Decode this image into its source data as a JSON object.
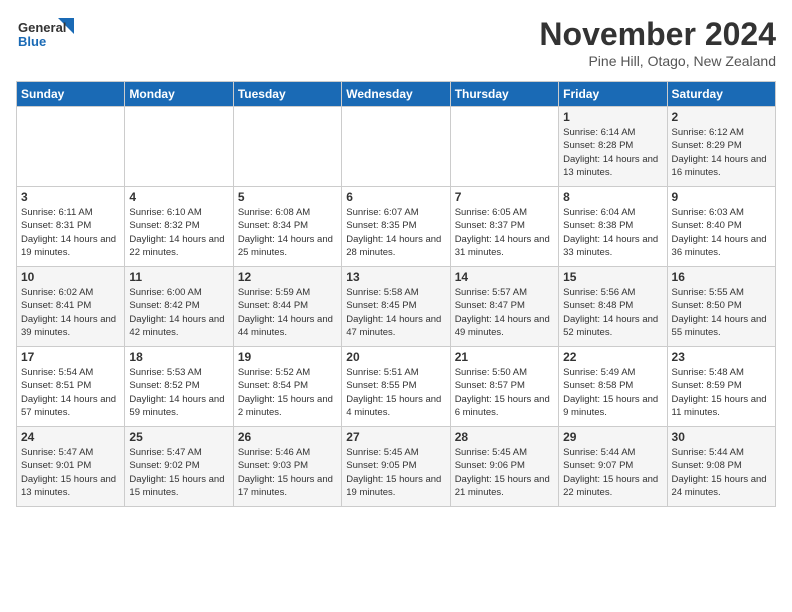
{
  "header": {
    "logo_general": "General",
    "logo_blue": "Blue",
    "title": "November 2024",
    "location": "Pine Hill, Otago, New Zealand"
  },
  "days_of_week": [
    "Sunday",
    "Monday",
    "Tuesday",
    "Wednesday",
    "Thursday",
    "Friday",
    "Saturday"
  ],
  "weeks": [
    [
      {
        "num": "",
        "info": ""
      },
      {
        "num": "",
        "info": ""
      },
      {
        "num": "",
        "info": ""
      },
      {
        "num": "",
        "info": ""
      },
      {
        "num": "",
        "info": ""
      },
      {
        "num": "1",
        "info": "Sunrise: 6:14 AM\nSunset: 8:28 PM\nDaylight: 14 hours and 13 minutes."
      },
      {
        "num": "2",
        "info": "Sunrise: 6:12 AM\nSunset: 8:29 PM\nDaylight: 14 hours and 16 minutes."
      }
    ],
    [
      {
        "num": "3",
        "info": "Sunrise: 6:11 AM\nSunset: 8:31 PM\nDaylight: 14 hours and 19 minutes."
      },
      {
        "num": "4",
        "info": "Sunrise: 6:10 AM\nSunset: 8:32 PM\nDaylight: 14 hours and 22 minutes."
      },
      {
        "num": "5",
        "info": "Sunrise: 6:08 AM\nSunset: 8:34 PM\nDaylight: 14 hours and 25 minutes."
      },
      {
        "num": "6",
        "info": "Sunrise: 6:07 AM\nSunset: 8:35 PM\nDaylight: 14 hours and 28 minutes."
      },
      {
        "num": "7",
        "info": "Sunrise: 6:05 AM\nSunset: 8:37 PM\nDaylight: 14 hours and 31 minutes."
      },
      {
        "num": "8",
        "info": "Sunrise: 6:04 AM\nSunset: 8:38 PM\nDaylight: 14 hours and 33 minutes."
      },
      {
        "num": "9",
        "info": "Sunrise: 6:03 AM\nSunset: 8:40 PM\nDaylight: 14 hours and 36 minutes."
      }
    ],
    [
      {
        "num": "10",
        "info": "Sunrise: 6:02 AM\nSunset: 8:41 PM\nDaylight: 14 hours and 39 minutes."
      },
      {
        "num": "11",
        "info": "Sunrise: 6:00 AM\nSunset: 8:42 PM\nDaylight: 14 hours and 42 minutes."
      },
      {
        "num": "12",
        "info": "Sunrise: 5:59 AM\nSunset: 8:44 PM\nDaylight: 14 hours and 44 minutes."
      },
      {
        "num": "13",
        "info": "Sunrise: 5:58 AM\nSunset: 8:45 PM\nDaylight: 14 hours and 47 minutes."
      },
      {
        "num": "14",
        "info": "Sunrise: 5:57 AM\nSunset: 8:47 PM\nDaylight: 14 hours and 49 minutes."
      },
      {
        "num": "15",
        "info": "Sunrise: 5:56 AM\nSunset: 8:48 PM\nDaylight: 14 hours and 52 minutes."
      },
      {
        "num": "16",
        "info": "Sunrise: 5:55 AM\nSunset: 8:50 PM\nDaylight: 14 hours and 55 minutes."
      }
    ],
    [
      {
        "num": "17",
        "info": "Sunrise: 5:54 AM\nSunset: 8:51 PM\nDaylight: 14 hours and 57 minutes."
      },
      {
        "num": "18",
        "info": "Sunrise: 5:53 AM\nSunset: 8:52 PM\nDaylight: 14 hours and 59 minutes."
      },
      {
        "num": "19",
        "info": "Sunrise: 5:52 AM\nSunset: 8:54 PM\nDaylight: 15 hours and 2 minutes."
      },
      {
        "num": "20",
        "info": "Sunrise: 5:51 AM\nSunset: 8:55 PM\nDaylight: 15 hours and 4 minutes."
      },
      {
        "num": "21",
        "info": "Sunrise: 5:50 AM\nSunset: 8:57 PM\nDaylight: 15 hours and 6 minutes."
      },
      {
        "num": "22",
        "info": "Sunrise: 5:49 AM\nSunset: 8:58 PM\nDaylight: 15 hours and 9 minutes."
      },
      {
        "num": "23",
        "info": "Sunrise: 5:48 AM\nSunset: 8:59 PM\nDaylight: 15 hours and 11 minutes."
      }
    ],
    [
      {
        "num": "24",
        "info": "Sunrise: 5:47 AM\nSunset: 9:01 PM\nDaylight: 15 hours and 13 minutes."
      },
      {
        "num": "25",
        "info": "Sunrise: 5:47 AM\nSunset: 9:02 PM\nDaylight: 15 hours and 15 minutes."
      },
      {
        "num": "26",
        "info": "Sunrise: 5:46 AM\nSunset: 9:03 PM\nDaylight: 15 hours and 17 minutes."
      },
      {
        "num": "27",
        "info": "Sunrise: 5:45 AM\nSunset: 9:05 PM\nDaylight: 15 hours and 19 minutes."
      },
      {
        "num": "28",
        "info": "Sunrise: 5:45 AM\nSunset: 9:06 PM\nDaylight: 15 hours and 21 minutes."
      },
      {
        "num": "29",
        "info": "Sunrise: 5:44 AM\nSunset: 9:07 PM\nDaylight: 15 hours and 22 minutes."
      },
      {
        "num": "30",
        "info": "Sunrise: 5:44 AM\nSunset: 9:08 PM\nDaylight: 15 hours and 24 minutes."
      }
    ]
  ]
}
